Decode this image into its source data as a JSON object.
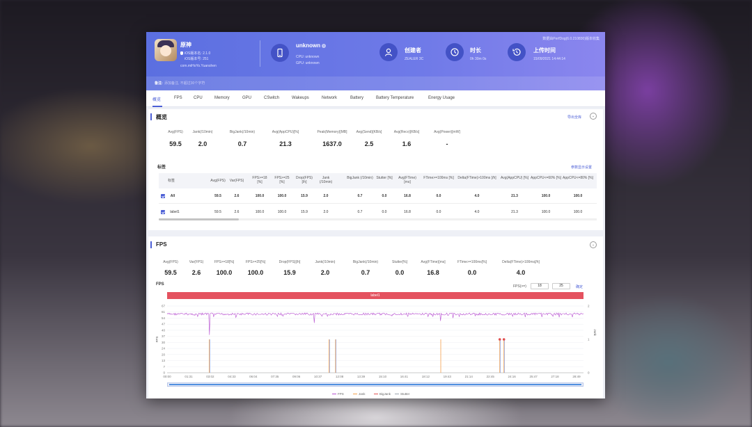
{
  "header": {
    "app_name": "原神",
    "ios_version": "iOS版本名: 2.1.0",
    "ios_build": "iOS版本号: 251",
    "bundle_id": "com.miHoYo.Yuanshen",
    "device_name": "unknown",
    "device_info_icon": "i",
    "cpu": "CPU: unknown",
    "gpu": "GPU: unknown",
    "creator_title": "创建者",
    "creator_value": "ZEALER 3C",
    "duration_title": "时长",
    "duration_value": "0h 30m 0s",
    "upload_title": "上传时间",
    "upload_value": "15/09/2021 14:44:14",
    "top_right": "数据由PerfDog(6.0.210830)版本收集",
    "note_label": "备注:",
    "note_placeholder": "添加备注, 不超过30个字符",
    "colors": {
      "header_start": "#5b6fe0",
      "header_end": "#8b86ee",
      "accent": "#4c5fd6"
    }
  },
  "tabs": [
    "概览",
    "FPS",
    "CPU",
    "Memory",
    "GPU",
    "CSwitch",
    "Wakeups",
    "Network",
    "Battery",
    "Battery Temperature",
    "Energy Usage"
  ],
  "overview": {
    "title": "概览",
    "export_link": "导出全库",
    "collapse_icon": "chevron-down-icon",
    "metrics": [
      {
        "label": "Avg(FPS)",
        "value": "59.5"
      },
      {
        "label": "Jank(/10min)",
        "value": "2.0"
      },
      {
        "label": "BigJank(/10min)",
        "value": "0.7"
      },
      {
        "label": "Avg(AppCPU)[%]",
        "value": "21.3"
      },
      {
        "label": "Peak(Memory)[MB]",
        "value": "1637.0"
      },
      {
        "label": "Avg(Send)[KB/s]",
        "value": "2.5"
      },
      {
        "label": "Avg(Recv)[KB/s]",
        "value": "1.6"
      },
      {
        "label": "Avg(Power)[mW]",
        "value": "-"
      }
    ],
    "labels_title": "标签",
    "labels_link": "参数显示设置",
    "table": {
      "headers": [
        "标签",
        "Avg(FPS)",
        "Var(FPS)",
        "FPS>=18 [%]",
        "FPS>=25 [%]",
        "Drop(FPS) [/h]",
        "Jank (/10min)",
        "BigJank (/10min)",
        "Stutter [%]",
        "Avg(FTime) [ms]",
        "FTime>=100ms [%]",
        "Delta(FTime)>100ms [/h]",
        "Avg(AppCPU) [%]",
        "AppCPU<=60% [%]",
        "AppCPU<=80% [%]"
      ],
      "rows": [
        {
          "cells": [
            "All",
            "59.5",
            "2.6",
            "100.0",
            "100.0",
            "15.9",
            "2.0",
            "0.7",
            "0.0",
            "16.8",
            "0.0",
            "4.0",
            "21.3",
            "100.0",
            "100.0"
          ]
        },
        {
          "cells": [
            "label1",
            "59.5",
            "2.6",
            "100.0",
            "100.0",
            "15.9",
            "2.0",
            "0.7",
            "0.0",
            "16.8",
            "0.0",
            "4.0",
            "21.3",
            "100.0",
            "100.0"
          ]
        }
      ]
    }
  },
  "fps_section": {
    "title": "FPS",
    "metrics": [
      {
        "label": "Avg(FPS)",
        "value": "59.5"
      },
      {
        "label": "Var(FPS)",
        "value": "2.6"
      },
      {
        "label": "FPS>=18[%]",
        "value": "100.0"
      },
      {
        "label": "FPS>=25[%]",
        "value": "100.0"
      },
      {
        "label": "Drop(FPS)[/h]",
        "value": "15.9"
      },
      {
        "label": "Jank(/10min)",
        "value": "2.0"
      },
      {
        "label": "BigJank(/10min)",
        "value": "0.7"
      },
      {
        "label": "Stutter[%]",
        "value": "0.0"
      },
      {
        "label": "Avg(FTime)[ms]",
        "value": "16.8"
      },
      {
        "label": "FTime>=100ms[%]",
        "value": "0.0"
      },
      {
        "label": "Delta(FTime)>100ms[/h]",
        "value": "4.0"
      }
    ],
    "chart_title": "FPS",
    "threshold_label": "FPS(>=)",
    "threshold_1": "18",
    "threshold_2": "25",
    "confirm_link": "确定"
  },
  "chart_data": {
    "type": "line",
    "label_band": "label1",
    "xlabel": "",
    "ylabel": "FPS",
    "y2label": "Jank",
    "y_ticks": [
      "67",
      "61",
      "54",
      "47",
      "40",
      "37",
      "30",
      "24",
      "20",
      "13",
      "7",
      "0"
    ],
    "y2_ticks": [
      "2",
      "1",
      "0"
    ],
    "ylim": [
      0,
      67
    ],
    "y2lim": [
      0,
      2
    ],
    "x_ticks": [
      "00:00",
      "01:31",
      "03:02",
      "04:33",
      "06:04",
      "07:35",
      "09:06",
      "10:37",
      "12:08",
      "13:39",
      "15:10",
      "16:41",
      "18:12",
      "19:43",
      "21:14",
      "22:45",
      "24:16",
      "25:47",
      "27:18",
      "28:49"
    ],
    "fps_baseline": 60,
    "fps_dips": [
      {
        "t": "03:02",
        "fps": 38
      },
      {
        "t": "10:37",
        "fps": 50
      },
      {
        "t": "19:43",
        "fps": 52
      }
    ],
    "jank_events": [
      "03:02",
      "11:40",
      "12:08",
      "19:43",
      "23:58",
      "24:16"
    ],
    "bigjank_events": [
      "03:02",
      "11:40",
      "12:08",
      "23:58",
      "24:16"
    ],
    "stutter_markers": [
      "23:58",
      "24:16"
    ],
    "series": [
      {
        "name": "FPS",
        "color": "#b64fd0"
      },
      {
        "name": "Jank",
        "color": "#f5a04a"
      },
      {
        "name": "BigJank",
        "color": "#e05050"
      },
      {
        "name": "Stutter",
        "color": "#9aa3ad"
      }
    ],
    "legend_position": "bottom"
  }
}
